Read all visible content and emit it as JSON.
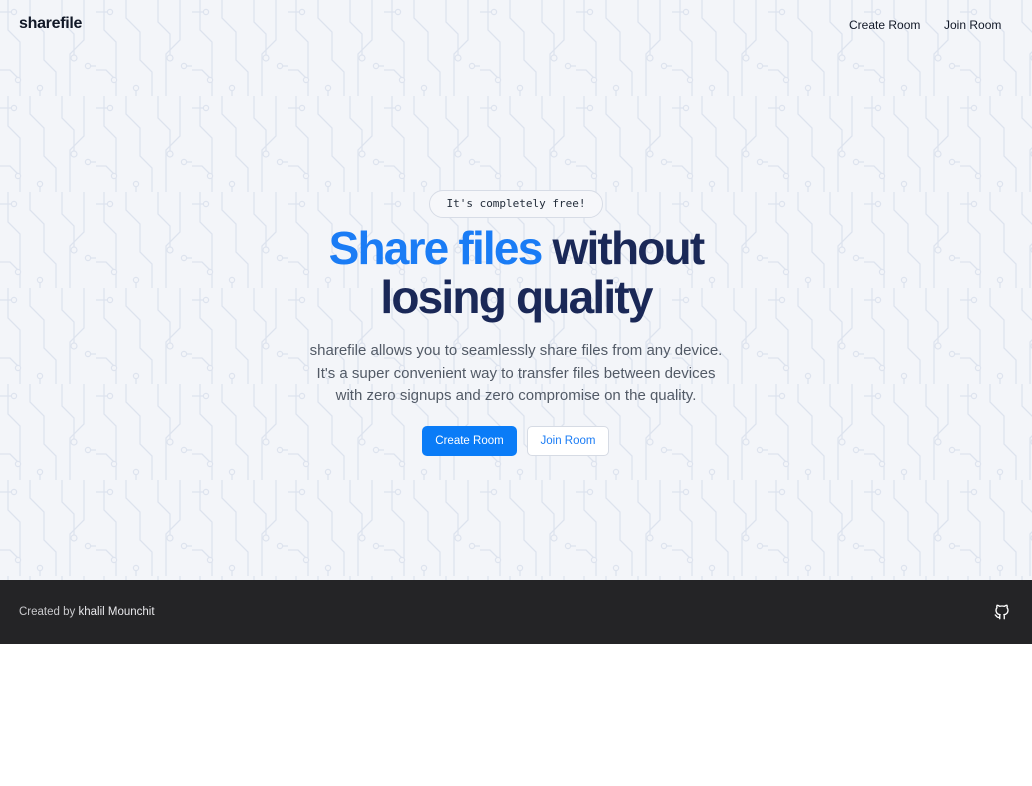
{
  "nav": {
    "logo": "sharefile",
    "create_room": "Create Room",
    "join_room": "Join Room"
  },
  "hero": {
    "badge": "It's completely free!",
    "headline_accent": "Share files",
    "headline_rest_1": "without",
    "headline_rest_2": "losing quality",
    "description_line_1": "sharefile allows you to seamlessly share files from any device.",
    "description_line_2": "It's a super convenient way to transfer files between devices",
    "description_line_3": "with zero signups and zero compromise on the quality.",
    "primary_button": "Create Room",
    "secondary_button": "Join Room"
  },
  "footer": {
    "credit_prefix": "Created by",
    "author": "khalil Mounchit",
    "icon": "github-icon"
  },
  "colors": {
    "accent": "#0a7cf7",
    "headline": "#1a2857",
    "footer_bg": "#242426",
    "hero_bg": "#f3f5f9"
  }
}
